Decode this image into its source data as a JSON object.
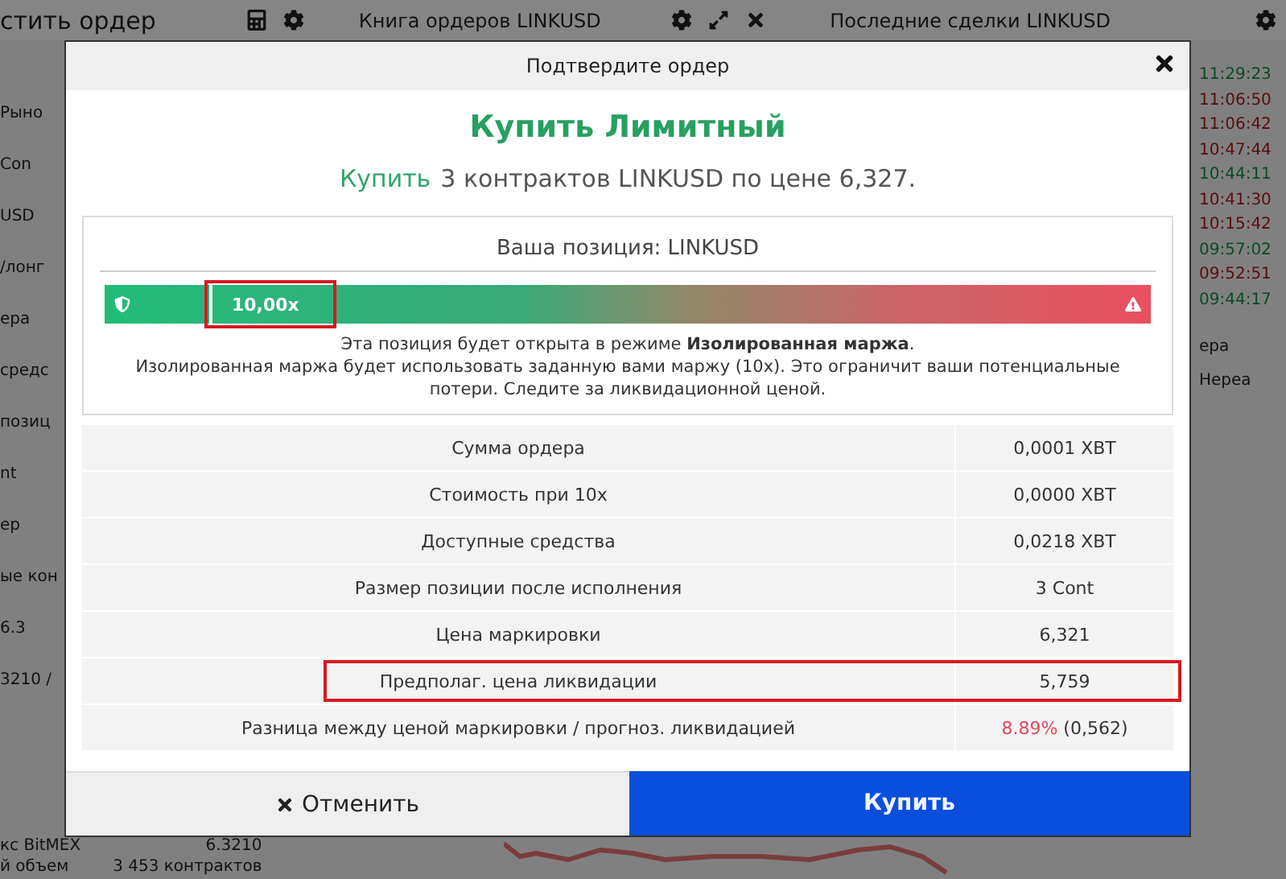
{
  "background": {
    "top_bar": {
      "left_title": "стить ордер",
      "order_book_title": "Книга ордеров LINKUSD",
      "trades_title": "Последние сделки LINKUSD"
    },
    "left_fragments": [
      "Рыно",
      "Con",
      "USD",
      "/лонг",
      "ера",
      "средс",
      "позиц",
      "nt",
      "ер",
      "ые кон",
      "6.3",
      "3210 /"
    ],
    "trades": [
      {
        "time": "11:29:23",
        "color": "#0b4a22"
      },
      {
        "time": "11:06:50",
        "color": "#5a0c0c"
      },
      {
        "time": "11:06:42",
        "color": "#5a0c0c"
      },
      {
        "time": "10:47:44",
        "color": "#5a0c0c"
      },
      {
        "time": "10:44:11",
        "color": "#0b4a22"
      },
      {
        "time": "10:41:30",
        "color": "#5a0c0c"
      },
      {
        "time": "10:15:42",
        "color": "#5a0c0c"
      },
      {
        "time": "09:57:02",
        "color": "#0b4a22"
      },
      {
        "time": "09:52:51",
        "color": "#5a0c0c"
      },
      {
        "time": "09:44:17",
        "color": "#0b4a22"
      }
    ],
    "right_fragments": [
      "ера",
      "Нереа"
    ],
    "stats": [
      {
        "label": "кс BitMEX",
        "value": "6.3210"
      },
      {
        "label": "й объем",
        "value": "3 453 контрактов"
      }
    ]
  },
  "dialog": {
    "title": "Подтвердите ордер",
    "heading": "Купить Лимитный",
    "summary_action": "Купить",
    "summary_text": "3 контрактов LINKUSD по цене 6,327.",
    "position": {
      "title": "Ваша позиция: LINKUSD",
      "leverage_label": "10,00x",
      "level": 0.1,
      "highlighted": true,
      "notice": "Эта позиция будет открыта в режиме **Изолированная маржа**.",
      "explanation": "Изолированная маржа будет использовать заданную вами маржу (10x). Это ограничит ваши потенциальные потери. Следите за ликвидационной ценой."
    },
    "rows": [
      {
        "label": "Сумма ордера",
        "value": [
          {
            "text": "0,0001 XBT",
            "color": "#333333"
          }
        ],
        "highlighted": false
      },
      {
        "label": "Стоимость при 10x",
        "value": [
          {
            "text": "0,0000 XBT",
            "color": "#333333"
          }
        ],
        "highlighted": false
      },
      {
        "label": "Доступные средства",
        "value": [
          {
            "text": "0,0218 XBT",
            "color": "#333333"
          }
        ],
        "highlighted": false
      },
      {
        "label": "Размер позиции после исполнения",
        "value": [
          {
            "text": "3 Cont",
            "color": "#333333"
          }
        ],
        "highlighted": false
      },
      {
        "label": "Цена маркировки",
        "value": [
          {
            "text": "6,321",
            "color": "#333333"
          }
        ],
        "highlighted": false
      },
      {
        "label": "Предполаг. цена ликвидации",
        "value": [
          {
            "text": "5,759",
            "color": "#333333"
          }
        ],
        "highlighted": true
      },
      {
        "label": "Разница между ценой маркировки / прогноз. ликвидацией",
        "value": [
          {
            "text": "8.89%",
            "color": "#e04b5a"
          },
          {
            "text": " (0,562)",
            "color": "#333333"
          }
        ],
        "highlighted": false
      }
    ],
    "cancel_label": "Отменить",
    "confirm_label": "Купить"
  }
}
